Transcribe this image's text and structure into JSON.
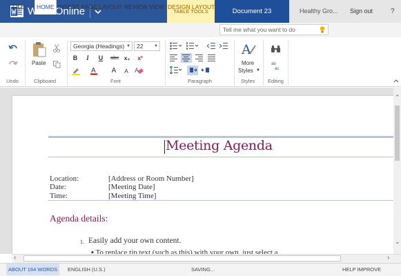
{
  "titlebar": {
    "app_name": "Word Online",
    "context_tab": "TABLE TOOLS",
    "document_title": "Document 23",
    "user": "Healthy Gro...",
    "signout": "Sign out",
    "help": "?",
    "color": "#2b579a"
  },
  "tabs": [
    {
      "label": "FILE"
    },
    {
      "label": "HOME"
    },
    {
      "label": "INSERT"
    },
    {
      "label": "PAGE LAYOUT"
    },
    {
      "label": "REVIEW"
    },
    {
      "label": "VIEW"
    },
    {
      "label": "DESIGN"
    },
    {
      "label": "LAYOUT"
    }
  ],
  "tellme": {
    "placeholder": "Tell me what you want to do"
  },
  "ribbon": {
    "undo_group": "Undo",
    "clipboard": {
      "paste": "Paste",
      "label": "Clipboard"
    },
    "font": {
      "name": "Georgia (Headings)",
      "size": "22",
      "bold": "B",
      "italic": "I",
      "underline": "U",
      "strike": "abc",
      "subscript": "x₂",
      "superscript": "x²",
      "grow": "A",
      "shrink": "A",
      "label": "Font"
    },
    "paragraph": {
      "label": "Paragraph"
    },
    "styles": {
      "more": "More",
      "styles": "Styles",
      "label": "Styles"
    },
    "editing": {
      "label": "Editing"
    }
  },
  "document": {
    "heading": "Meeting Agenda",
    "fields": [
      {
        "label": "Location:",
        "value": "[Address or Room Number]"
      },
      {
        "label": "Date:",
        "value": "[Meeting Date]"
      },
      {
        "label": "Time:",
        "value": "[Meeting Time]"
      }
    ],
    "agenda_heading": "Agenda details:",
    "list_number": "1.",
    "list_item": "Easily add your own content.",
    "sub_item": "To replace tip text (such as this) with your own, just select a"
  },
  "statusbar": {
    "words": "ABOUT 164 WORDS",
    "language": "ENGLISH (U.S.)",
    "saving": "SAVING...",
    "help": "HELP IMPROVE OFFICE"
  }
}
